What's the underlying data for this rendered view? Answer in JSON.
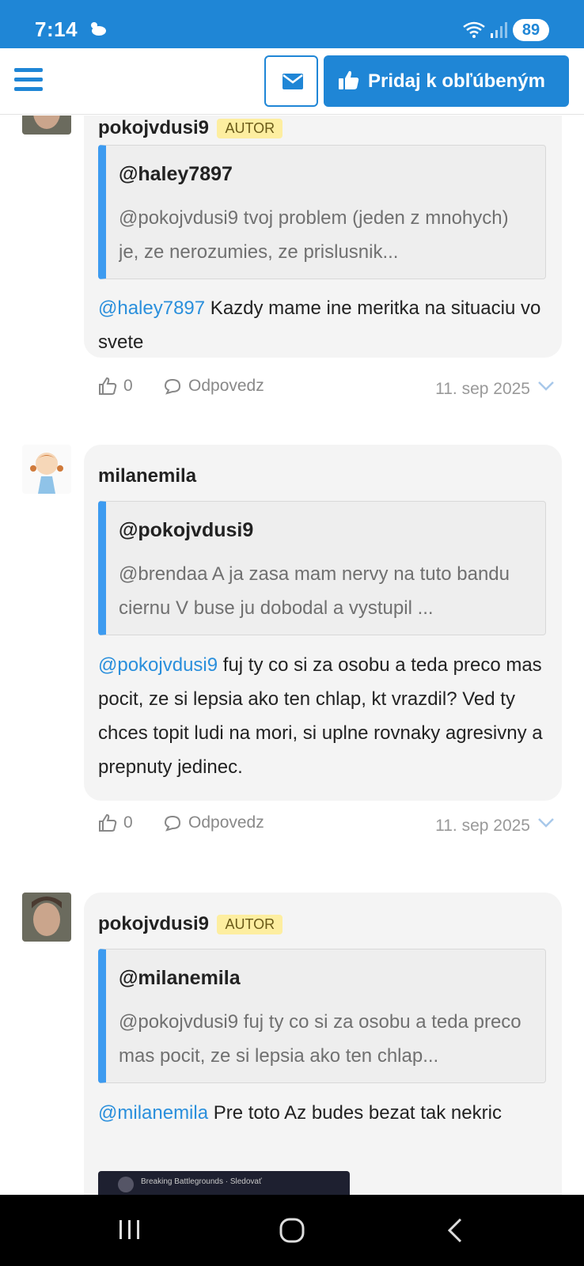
{
  "status_bar": {
    "time": "7:14",
    "battery": "89",
    "icons": [
      "weather-icon",
      "wifi-icon",
      "signal-icon"
    ]
  },
  "header": {
    "menu_icon": "hamburger-icon",
    "mail_icon": "envelope-icon",
    "favorite_label": "Pridaj k obľúbeným",
    "favorite_icon": "thumbs-up-icon"
  },
  "colors": {
    "primary": "#1f86d6",
    "quote_bar": "#3d9bf0",
    "mention": "#2a8fdc",
    "badge_bg": "#fdeea0",
    "bubble_bg": "#f4f4f4"
  },
  "comments": [
    {
      "author": "pokojvdusi9",
      "badge": "AUTOR",
      "quote_user": "@haley7897",
      "quote_text": "@pokojvdusi9 tvoj problem (jeden z mnohych) je, ze nerozumies, ze prislusnik...",
      "mention": "@haley7897",
      "text": " Kazdy mame ine meritka na situaciu vo svete",
      "likes": "0",
      "reply_label": "Odpovedz",
      "date": "11. sep 2025"
    },
    {
      "author": "milanemila",
      "quote_user": "@pokojvdusi9",
      "quote_text": "@brendaa A ja zasa mam nervy na tuto bandu ciernu V buse ju dobodal a vystupil ...",
      "mention": "@pokojvdusi9",
      "text": " fuj ty co si za osobu a teda preco mas pocit, ze si lepsia ako ten chlap, kt vrazdil? Ved ty chces topit ludi na mori, si uplne rovnaky agresivny a prepnuty jedinec.",
      "likes": "0",
      "reply_label": "Odpovedz",
      "date": "11. sep 2025"
    },
    {
      "author": "pokojvdusi9",
      "badge": "AUTOR",
      "quote_user": "@milanemila",
      "quote_text": "@pokojvdusi9 fuj ty co si za osobu a teda preco mas pocit, ze si lepsia ako ten chlap...",
      "mention": "@milanemila",
      "text": " Pre toto Az budes bezat tak nekric",
      "embed_title": "Breaking Battlegrounds · Sledovať"
    }
  ],
  "nav": {
    "icons": [
      "recent-apps-icon",
      "home-icon",
      "back-icon"
    ]
  }
}
